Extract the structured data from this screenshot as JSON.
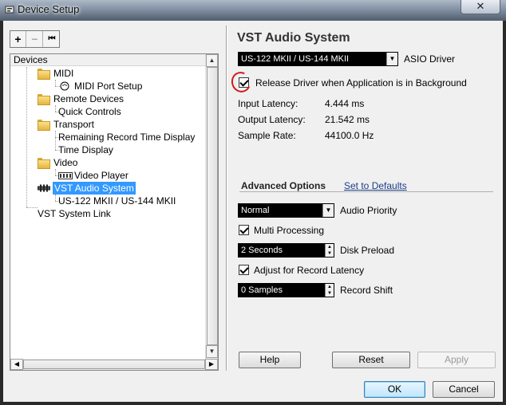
{
  "window": {
    "title": "Device Setup",
    "close_glyph": "✕"
  },
  "toolbar": {
    "add_glyph": "+",
    "remove_glyph": "−",
    "reset_glyph": "⏮"
  },
  "devices": {
    "header": "Devices",
    "tree": [
      {
        "label": "MIDI",
        "icon": "folder-icon"
      },
      {
        "label": "MIDI Port Setup",
        "icon": "midi-port-icon"
      },
      {
        "label": "Remote Devices",
        "icon": "folder-icon"
      },
      {
        "label": "Quick Controls",
        "icon": "none"
      },
      {
        "label": "Transport",
        "icon": "folder-icon"
      },
      {
        "label": "Remaining Record Time Display",
        "icon": "none"
      },
      {
        "label": "Time Display",
        "icon": "none"
      },
      {
        "label": "Video",
        "icon": "folder-icon"
      },
      {
        "label": "Video Player",
        "icon": "video-icon"
      },
      {
        "label": "VST Audio System",
        "icon": "vst-audio-icon",
        "selected": true
      },
      {
        "label": "US-122 MKII / US-144 MKII",
        "icon": "none"
      },
      {
        "label": "VST System Link",
        "icon": "none"
      }
    ]
  },
  "panel": {
    "title": "VST Audio System",
    "driver_value": "US-122 MKII / US-144 MKII",
    "driver_label": "ASIO Driver",
    "release_label": "Release Driver when Application is in Background",
    "release_checked": true,
    "input_latency_label": "Input Latency:",
    "input_latency_value": "4.444 ms",
    "output_latency_label": "Output Latency:",
    "output_latency_value": "21.542 ms",
    "sample_rate_label": "Sample Rate:",
    "sample_rate_value": "44100.0 Hz",
    "advanced_title": "Advanced Options",
    "set_defaults": "Set to Defaults",
    "audio_priority_value": "Normal",
    "audio_priority_label": "Audio Priority",
    "multi_processing_label": "Multi Processing",
    "multi_processing_checked": true,
    "disk_preload_value": "2 Seconds",
    "disk_preload_label": "Disk Preload",
    "adjust_latency_label": "Adjust for Record Latency",
    "adjust_latency_checked": true,
    "record_shift_value": "0 Samples",
    "record_shift_label": "Record Shift"
  },
  "buttons": {
    "help": "Help",
    "reset": "Reset",
    "apply": "Apply",
    "ok": "OK",
    "cancel": "Cancel"
  }
}
